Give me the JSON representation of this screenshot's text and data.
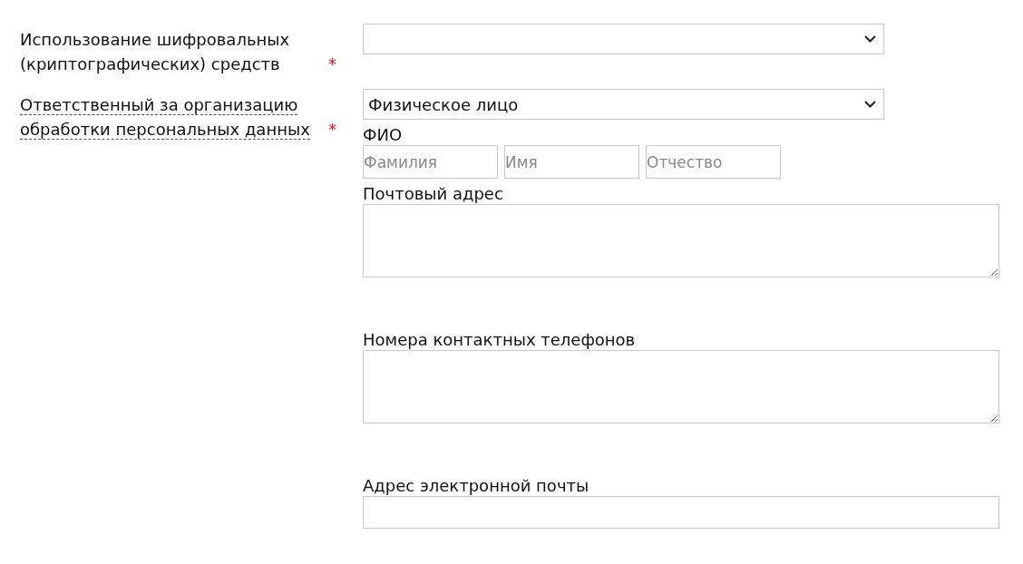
{
  "fields": [
    {
      "kind": "select",
      "label": "Использование шифровальных (криптографических) средств",
      "required_mark": "*",
      "hint": false
    },
    {
      "kind": "select",
      "label": "Ответственный за организацию обработки персональных данных",
      "required_mark": "*",
      "hint": true,
      "value": "Физическое лицо",
      "subfields": [
        {
          "kind": "name-group",
          "label": "ФИО",
          "inputs": [
            {
              "placeholder": "Фамилия"
            },
            {
              "placeholder": "Имя"
            },
            {
              "placeholder": "Отчество"
            }
          ]
        },
        {
          "kind": "textarea",
          "label": "Почтовый адрес"
        },
        {
          "kind": "textarea",
          "label": "Номера контактных телефонов"
        },
        {
          "kind": "input",
          "label": "Адрес электронной почты"
        }
      ]
    }
  ]
}
